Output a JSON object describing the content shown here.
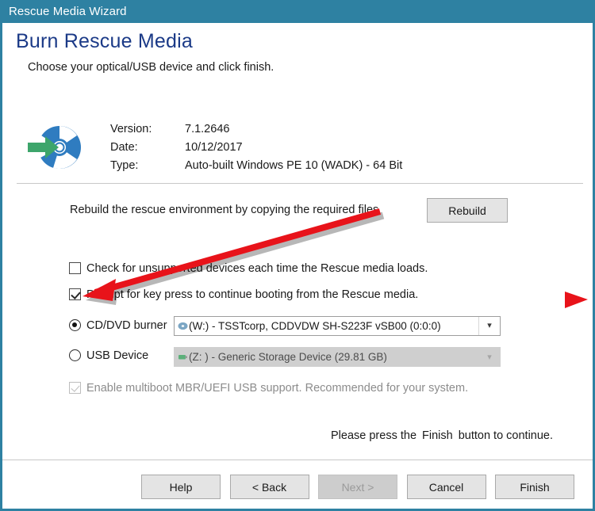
{
  "window": {
    "title": "Rescue Media Wizard"
  },
  "header": {
    "heading": "Burn Rescue Media",
    "subheading": "Choose your optical/USB device and click finish."
  },
  "info": {
    "icon": "disc-burn-icon",
    "rows": [
      {
        "label": "Version:",
        "value": "7.1.2646"
      },
      {
        "label": "Date:",
        "value": "10/12/2017"
      },
      {
        "label": "Type:",
        "value": "Auto-built Windows PE 10 (WADK) - 64 Bit"
      }
    ]
  },
  "rebuild": {
    "description": "Rebuild the rescue environment by copying the required files",
    "button_label": "Rebuild"
  },
  "options": {
    "check_unsupported": {
      "label": "Check for unsupported devices each time the Rescue media loads.",
      "checked": false,
      "enabled": true
    },
    "prompt_key_press": {
      "label": "Prompt for key press to continue booting from the Rescue media.",
      "checked": true,
      "enabled": true
    },
    "enable_multiboot": {
      "label": "Enable multiboot MBR/UEFI USB support. Recommended for your system.",
      "checked": true,
      "enabled": false
    }
  },
  "devices": {
    "cd": {
      "radio_label": "CD/DVD burner",
      "selected": true,
      "device_icon": "optical-drive-icon",
      "value": "(W:) - TSSTcorp, CDDVDW SH-S223F  vSB00 (0:0:0)",
      "arrow_icon": "chevron-down-icon",
      "enabled": true
    },
    "usb": {
      "radio_label": "USB Device",
      "selected": false,
      "device_icon": "usb-drive-icon",
      "value": "(Z: ) - Generic Storage Device (29.81 GB)",
      "arrow_icon": "chevron-down-icon",
      "enabled": false
    }
  },
  "finish_message": {
    "prefix": "Please press the",
    "emphasis": "Finish",
    "suffix": "button to continue."
  },
  "footer": {
    "buttons": [
      {
        "label": "Help",
        "enabled": true
      },
      {
        "label": "< Back",
        "enabled": true
      },
      {
        "label": "Next >",
        "enabled": false
      },
      {
        "label": "Cancel",
        "enabled": true
      },
      {
        "label": "Finish",
        "enabled": true
      }
    ]
  },
  "annotations": {
    "pointer_arrow": "red-arrow-annotation",
    "edge_marker": "red-triangle-marker"
  },
  "colors": {
    "titlebar": "#2e81a2",
    "heading": "#1b3a87",
    "annotation": "#e8131a",
    "disc_blue": "#2f7cc0",
    "disc_green": "#3da56b"
  }
}
